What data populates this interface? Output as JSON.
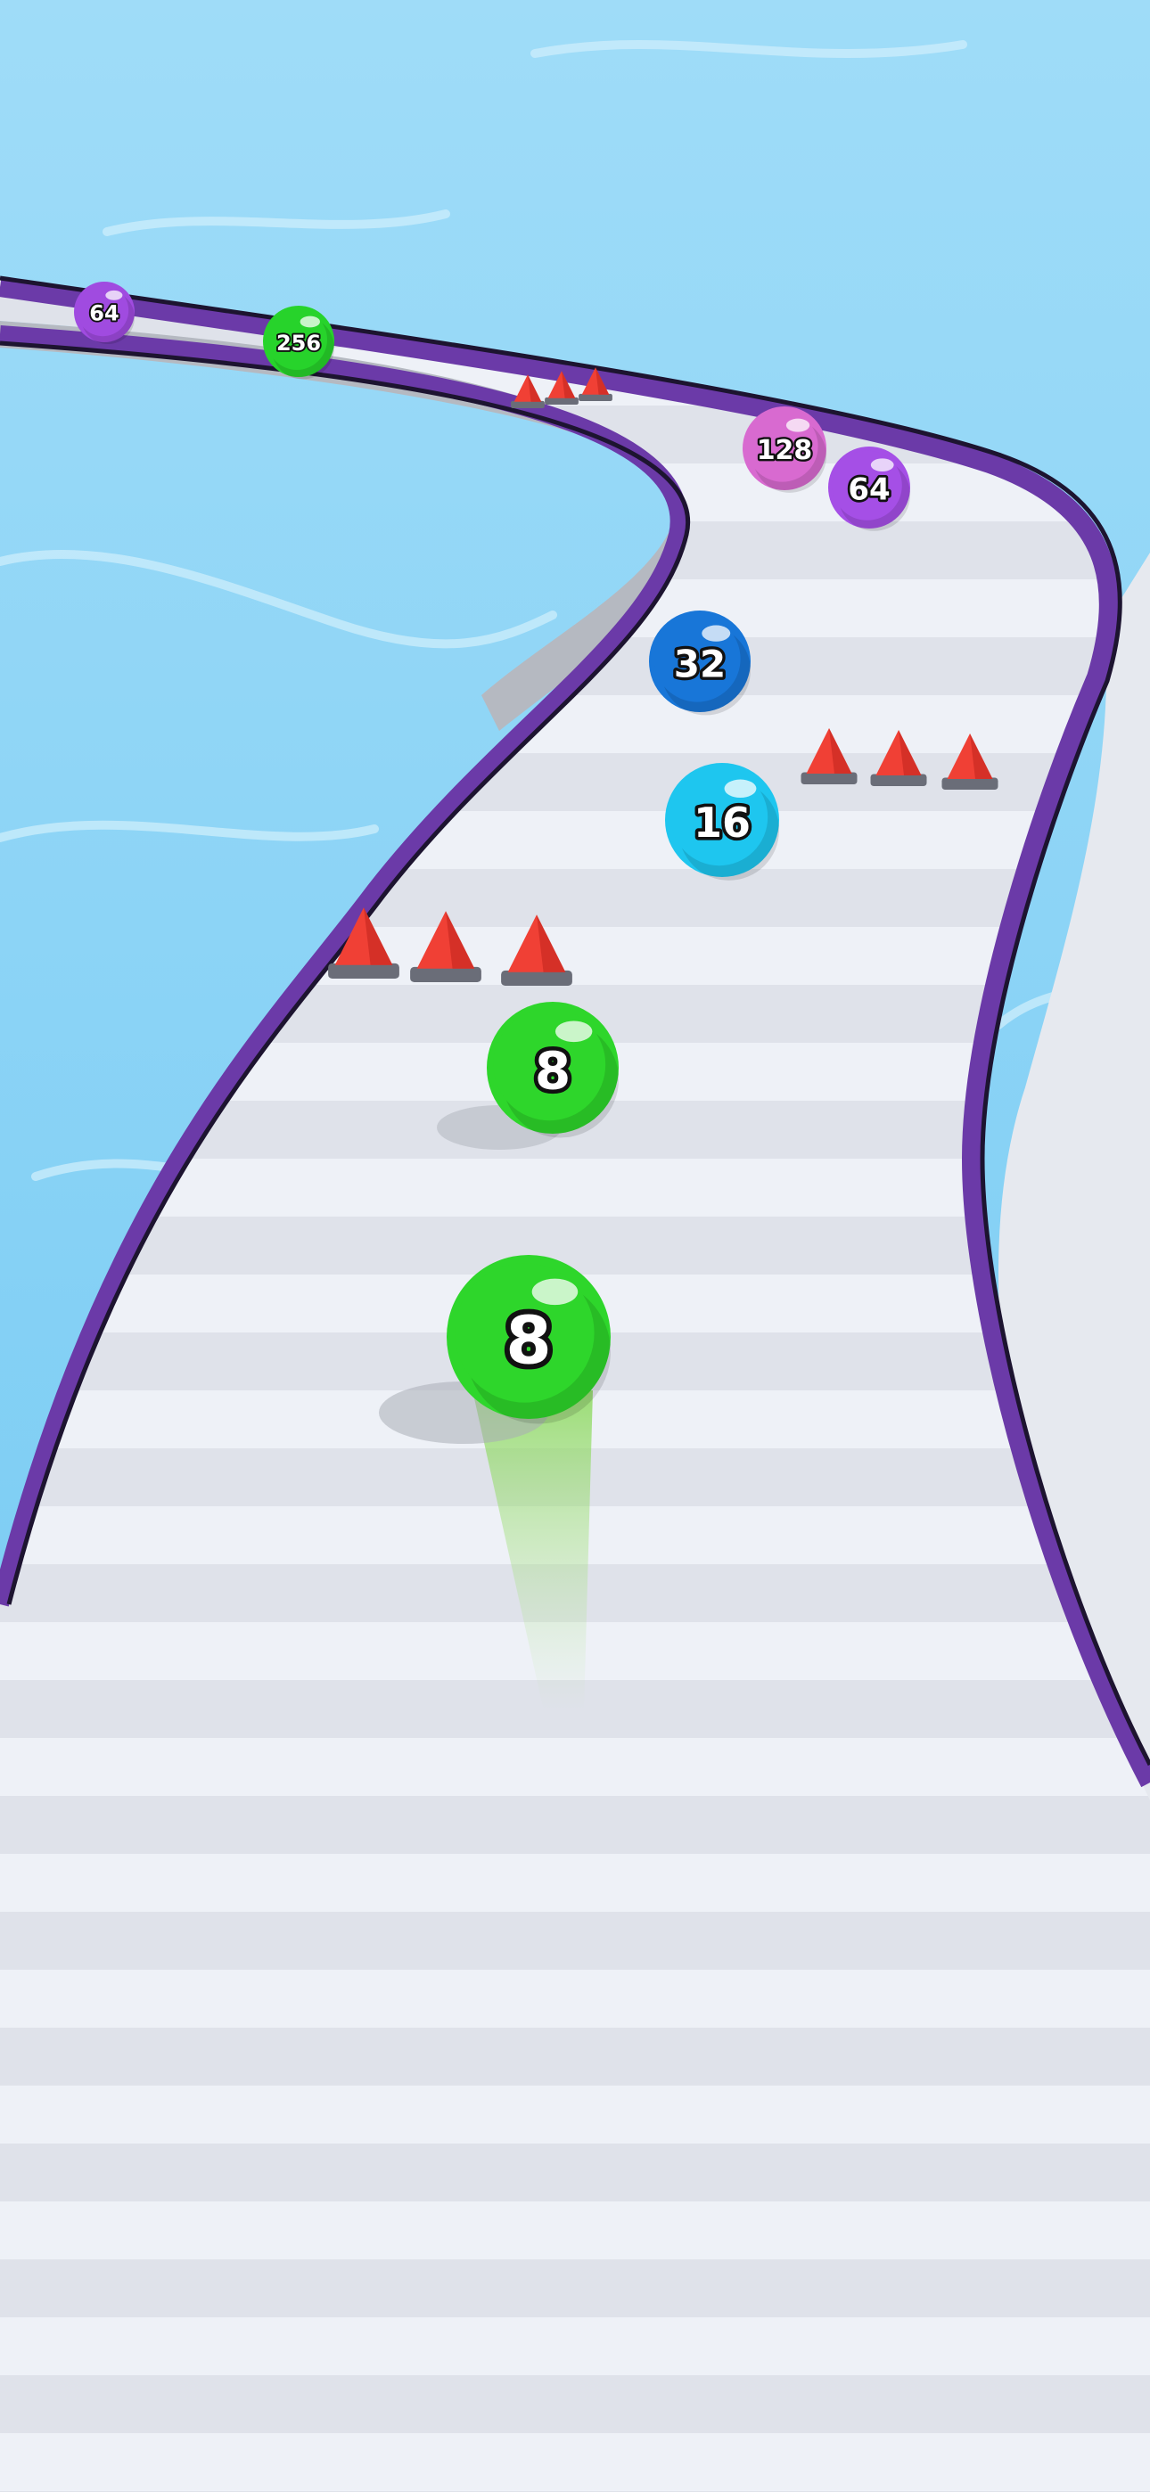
{
  "game": {
    "title": "",
    "player": {
      "value": "8",
      "color": "#2ed62b"
    },
    "balls": [
      {
        "id": "ball-64-far-left",
        "value": "64",
        "color": "#a04be0"
      },
      {
        "id": "ball-256",
        "value": "256",
        "color": "#27d32b"
      },
      {
        "id": "ball-128",
        "value": "128",
        "color": "#d86ad0"
      },
      {
        "id": "ball-64-right",
        "value": "64",
        "color": "#a54fe6"
      },
      {
        "id": "ball-32",
        "value": "32",
        "color": "#1876d8"
      },
      {
        "id": "ball-16",
        "value": "16",
        "color": "#1ec6ef"
      },
      {
        "id": "ball-8-ahead",
        "value": "8",
        "color": "#2ed62b"
      }
    ],
    "obstacle_groups": [
      {
        "id": "spikes-far",
        "count": 3
      },
      {
        "id": "spikes-right",
        "count": 3
      },
      {
        "id": "spikes-left",
        "count": 3
      }
    ],
    "colors": {
      "water": "#7fd0f5",
      "track_light": "#eef1f7",
      "track_stripe": "#dcdfe8",
      "rail": "#6b3aa8",
      "spike": "#f04035",
      "spike_base": "#6a6d78"
    }
  }
}
